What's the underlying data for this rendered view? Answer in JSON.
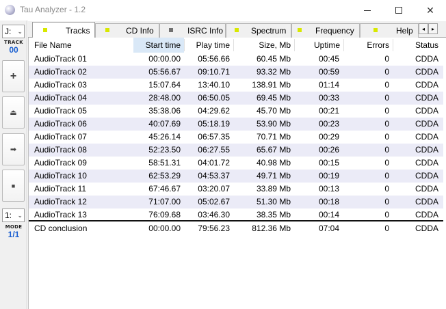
{
  "window": {
    "title": "Tau Analyzer - 1.2",
    "min_glyph": "—",
    "max_glyph": "☐",
    "close_glyph": "✕"
  },
  "sidebar": {
    "drive": "J:",
    "track_label": "TRACK",
    "track_value": "00",
    "mode_select": "1:",
    "mode_label": "MODE",
    "mode_value": "1/1",
    "buttons": [
      {
        "name": "add",
        "glyph": "+"
      },
      {
        "name": "eject",
        "glyph": "⏏"
      },
      {
        "name": "next",
        "glyph": "➡"
      },
      {
        "name": "stop",
        "glyph": "■"
      }
    ]
  },
  "tabs": [
    {
      "label": "Tracks",
      "marker_color": "#d8e800",
      "active": true
    },
    {
      "label": "CD Info",
      "marker_color": "#d8e800",
      "active": false
    },
    {
      "label": "ISRC Info",
      "marker_color": "#707070",
      "active": false
    },
    {
      "label": "Spectrum",
      "marker_color": "#d8e800",
      "active": false
    },
    {
      "label": "Frequency",
      "marker_color": "#d8e800",
      "active": false
    },
    {
      "label": "Help",
      "marker_color": "#d8e800",
      "active": false
    }
  ],
  "tab_scroll": {
    "left": "◂",
    "right": "▸"
  },
  "table": {
    "columns": [
      "File Name",
      "Start time",
      "Play time",
      "Size, Mb",
      "Uptime",
      "Errors",
      "Status"
    ],
    "sorted_column": "Start time",
    "rows": [
      [
        "AudioTrack 01",
        "00:00.00",
        "05:56.66",
        "60.45 Mb",
        "00:45",
        "0",
        "CDDA"
      ],
      [
        "AudioTrack 02",
        "05:56.67",
        "09:10.71",
        "93.32 Mb",
        "00:59",
        "0",
        "CDDA"
      ],
      [
        "AudioTrack 03",
        "15:07.64",
        "13:40.10",
        "138.91 Mb",
        "01:14",
        "0",
        "CDDA"
      ],
      [
        "AudioTrack 04",
        "28:48.00",
        "06:50.05",
        "69.45 Mb",
        "00:33",
        "0",
        "CDDA"
      ],
      [
        "AudioTrack 05",
        "35:38.06",
        "04:29.62",
        "45.70 Mb",
        "00:21",
        "0",
        "CDDA"
      ],
      [
        "AudioTrack 06",
        "40:07.69",
        "05:18.19",
        "53.90 Mb",
        "00:23",
        "0",
        "CDDA"
      ],
      [
        "AudioTrack 07",
        "45:26.14",
        "06:57.35",
        "70.71 Mb",
        "00:29",
        "0",
        "CDDA"
      ],
      [
        "AudioTrack 08",
        "52:23.50",
        "06:27.55",
        "65.67 Mb",
        "00:26",
        "0",
        "CDDA"
      ],
      [
        "AudioTrack 09",
        "58:51.31",
        "04:01.72",
        "40.98 Mb",
        "00:15",
        "0",
        "CDDA"
      ],
      [
        "AudioTrack 10",
        "62:53.29",
        "04:53.37",
        "49.71 Mb",
        "00:19",
        "0",
        "CDDA"
      ],
      [
        "AudioTrack 11",
        "67:46.67",
        "03:20.07",
        "33.89 Mb",
        "00:13",
        "0",
        "CDDA"
      ],
      [
        "AudioTrack 12",
        "71:07.00",
        "05:02.67",
        "51.30 Mb",
        "00:18",
        "0",
        "CDDA"
      ],
      [
        "AudioTrack 13",
        "76:09.68",
        "03:46.30",
        "38.35 Mb",
        "00:14",
        "0",
        "CDDA"
      ]
    ],
    "summary": [
      "CD conclusion",
      "00:00.00",
      "79:56.23",
      "812.36 Mb",
      "07:04",
      "0",
      "CDDA"
    ]
  }
}
